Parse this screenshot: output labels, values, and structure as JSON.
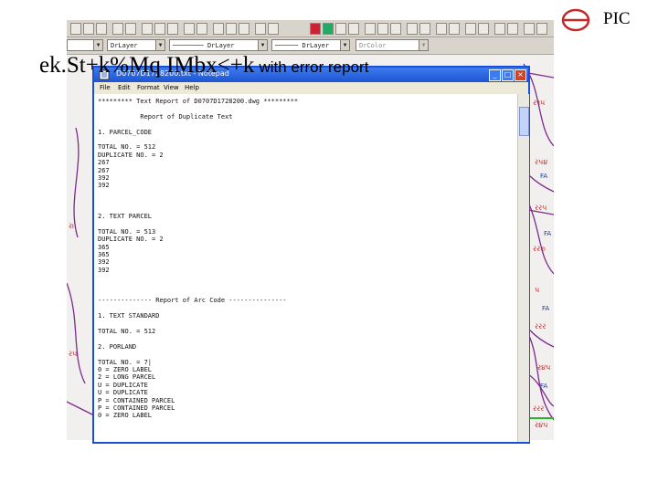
{
  "logo": {
    "text": "PIC",
    "icon": "pic-logo-icon",
    "color": "#c62828"
  },
  "autocad": {
    "layer_combo": "DrLayer",
    "linetype_combo_1": "DrLayer",
    "linetype_combo_2": "DrLayer",
    "color_combo": "DrColor"
  },
  "notepad": {
    "title": "D0707D1728200.txt - Notepad",
    "menu": [
      "File",
      "Edit",
      "Format",
      "View",
      "Help"
    ],
    "lines": [
      "********* Text Report of D0707D1728200.dwg *********",
      "",
      "           Report of Duplicate Text",
      "",
      "1. PARCEL_CODE",
      "",
      "TOTAL NO. = 512",
      "DUPLICATE NO. = 2",
      "267",
      "267",
      "392",
      "392",
      "",
      "",
      "",
      "2. TEXT PARCEL",
      "",
      "TOTAL NO. = 513",
      "DUPLICATE NO. = 2",
      "365",
      "365",
      "392",
      "392",
      "",
      "",
      "",
      "-------------- Report of Arc Code ---------------",
      "",
      "1. TEXT STANDARD",
      "",
      "TOTAL NO. = 512",
      "",
      "2. PORLAND",
      "",
      "TOTAL NO. = 7|",
      "0 = ZERO LABEL",
      "2 = LONG PARCEL",
      "U = DUPLICATE",
      "U = DUPLICATE",
      "P = CONTAINED PARCEL",
      "P = CONTAINED PARCEL",
      "0 = ZERO LABEL"
    ]
  },
  "overlay": {
    "main": "ek.St+k%Mq IMbx<+k",
    "sub": "with error report"
  }
}
